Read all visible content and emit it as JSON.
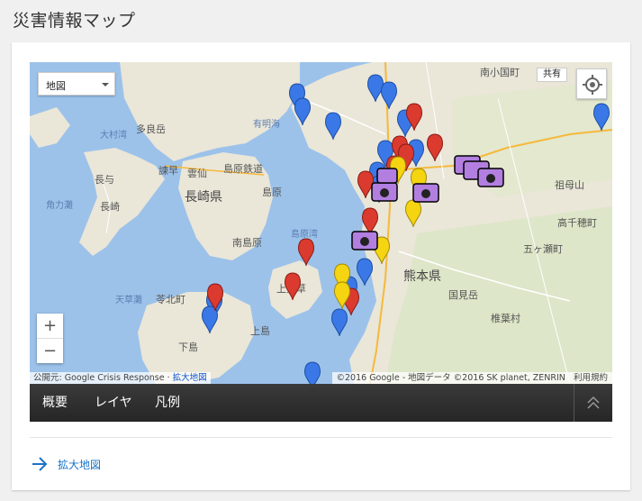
{
  "page": {
    "title": "災害情報マップ"
  },
  "map": {
    "type_selector": "地図",
    "share_label": "共有",
    "zoom_in": "+",
    "zoom_out": "−",
    "attribution": {
      "published": "公開元: Google Crisis Response",
      "enlarge": "拡大地図"
    },
    "copyright": "©2016 Google - 地図データ ©2016 SK planet, ZENRIN",
    "terms": "利用規約",
    "labels": {
      "nagasaki_pref": "長崎県",
      "kumamoto_pref": "熊本県",
      "unzen": "雲仙",
      "shimabara_rail": "島原鉄道",
      "shimabara": "島原",
      "minami_shimabara": "南島原",
      "isahaya": "諫早",
      "nagayo": "長与",
      "nagasaki": "長崎",
      "omura_bay": "大村湾",
      "taradake": "多良岳",
      "ariake_sea": "有明海",
      "minami_oguni": "南小国町",
      "sobosan": "祖母山",
      "takachiho": "高千穂町",
      "gokase": "五ヶ瀬町",
      "kunimidake": "国見岳",
      "shiiba": "椎葉村",
      "kamiamakusa": "上天草",
      "kamishima": "上島",
      "shimoshima": "下島",
      "reihoku": "苓北町",
      "amakusa_nada": "天草灘",
      "kadowaki": "角力灘",
      "shimabara_sea": "島原湾"
    }
  },
  "tabs": [
    {
      "label": "概要"
    },
    {
      "label": "レイヤ"
    },
    {
      "label": "凡例"
    }
  ],
  "footer": {
    "enlarge_link": "拡大地図"
  },
  "colors": {
    "accent": "#1a73c8",
    "pin_blue": "#3b78e7",
    "pin_red": "#db3b2f",
    "pin_yellow": "#f5d411",
    "camera": "#b27fe0"
  }
}
